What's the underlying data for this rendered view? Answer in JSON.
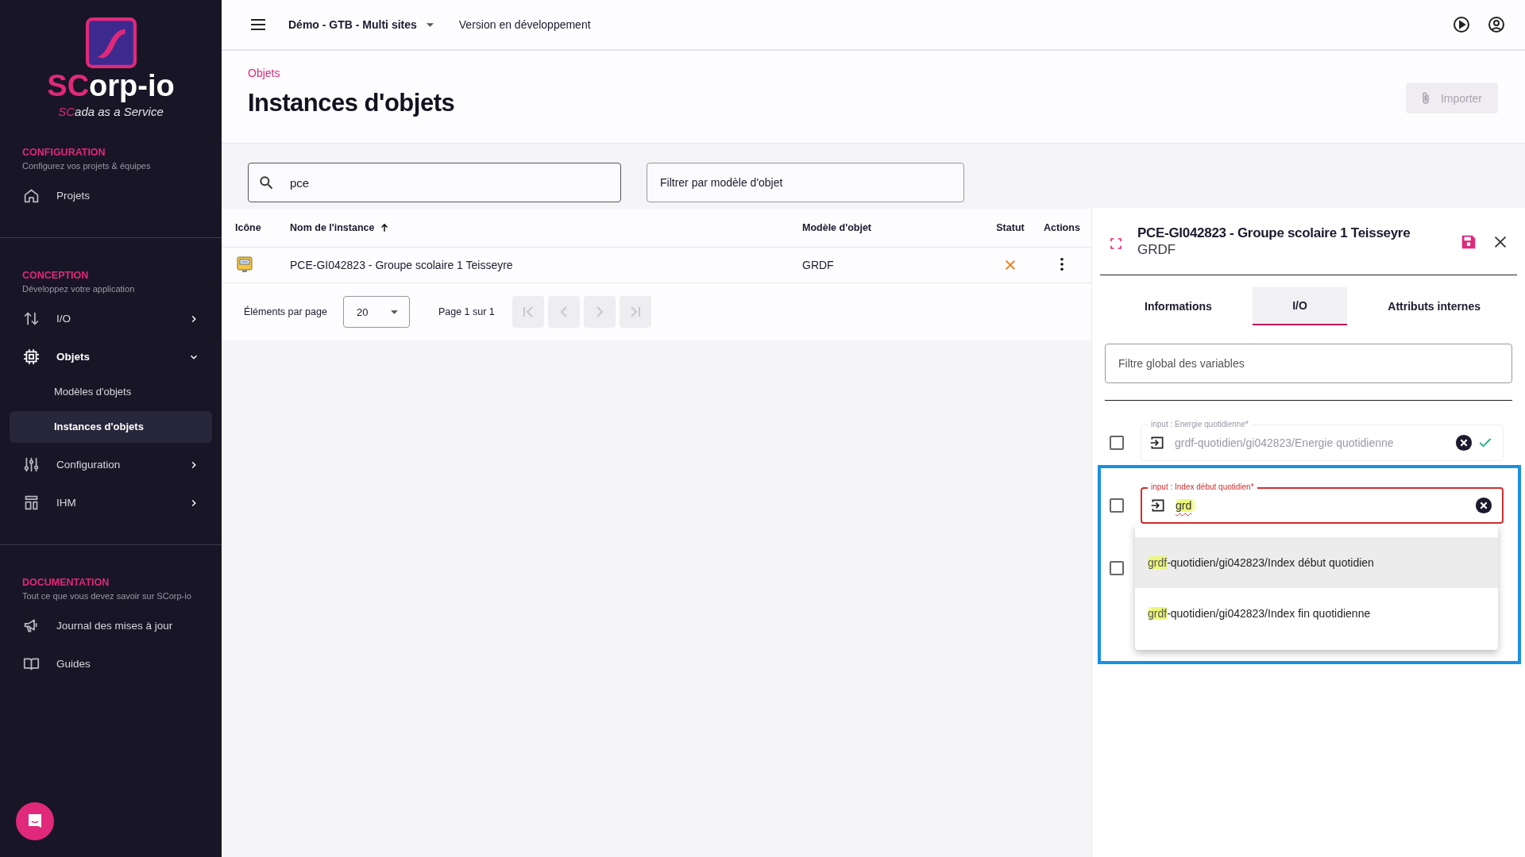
{
  "sidebar": {
    "logo": {
      "brand_accent": "SC",
      "brand_rest": "orp-io",
      "tagline_accent": "SC",
      "tagline_rest": "ada as a Service"
    },
    "sections": [
      {
        "title": "CONFIGURATION",
        "subtitle": "Configurez vos projets & équipes",
        "items": [
          {
            "label": "Projets"
          }
        ]
      },
      {
        "title": "CONCEPTION",
        "subtitle": "Développez votre application",
        "items": [
          {
            "label": "I/O",
            "expanded": false
          },
          {
            "label": "Objets",
            "expanded": true,
            "children": [
              {
                "label": "Modèles d'objets",
                "selected": false
              },
              {
                "label": "Instances d'objets",
                "selected": true
              }
            ]
          },
          {
            "label": "Configuration",
            "expanded": false
          },
          {
            "label": "IHM",
            "expanded": false
          }
        ]
      },
      {
        "title": "DOCUMENTATION",
        "subtitle": "Tout ce que vous devez savoir sur SCorp-io",
        "items": [
          {
            "label": "Journal des mises à jour"
          },
          {
            "label": "Guides"
          }
        ]
      }
    ]
  },
  "header": {
    "project": "Démo - GTB - Multi sites",
    "version": "Version en développement"
  },
  "page": {
    "breadcrumb": "Objets",
    "title": "Instances d'objets",
    "import_button": {
      "label": "Importer",
      "disabled": true
    }
  },
  "filters": {
    "search": {
      "value": "pce"
    },
    "model_filter": {
      "placeholder": "Filtrer par modèle d'objet"
    }
  },
  "table": {
    "columns": [
      {
        "label": "Icône"
      },
      {
        "label": "Nom de l'instance",
        "sorted": true
      },
      {
        "label": "Modèle d'objet"
      },
      {
        "label": "Statut"
      },
      {
        "label": "Actions"
      }
    ],
    "rows": [
      {
        "name": "PCE-GI042823 - Groupe scolaire 1 Teisseyre",
        "model": "GRDF",
        "valid": false
      }
    ]
  },
  "pagination": {
    "per_page_label": "Éléments par page",
    "per_page": "20",
    "page_label": "Page 1 sur 1",
    "nav_buttons": [
      {
        "kind": "first",
        "disabled": true
      },
      {
        "kind": "previous",
        "disabled": true
      },
      {
        "kind": "next",
        "disabled": true
      },
      {
        "kind": "last",
        "disabled": true
      }
    ]
  },
  "panel": {
    "title": "PCE-GI042823 - Groupe scolaire 1 Teisseyre",
    "subtitle": "GRDF",
    "tabs": [
      {
        "label": "Informations",
        "selected": false
      },
      {
        "label": "I/O",
        "selected": true
      },
      {
        "label": "Attributs internes",
        "selected": false
      }
    ],
    "filter": {
      "placeholder": "Filtre global des variables"
    },
    "variables": [
      {
        "label": "input : Energie quotidienne*",
        "value": "grdf-quotidien/gi042823/Energie quotidienne",
        "checked": false,
        "focused": false,
        "valid": true
      },
      {
        "label": "input : Index début quotidien*",
        "value": "grd",
        "checked": false,
        "focused": true,
        "valid": false
      },
      {
        "checked": false
      }
    ],
    "suggestions": [
      {
        "match": "grdf",
        "rest": "-quotidien/gi042823/Index début quotidien",
        "selected": true
      },
      {
        "match": "grdf",
        "rest": "-quotidien/gi042823/Index fin quotidienne",
        "selected": false
      }
    ]
  }
}
